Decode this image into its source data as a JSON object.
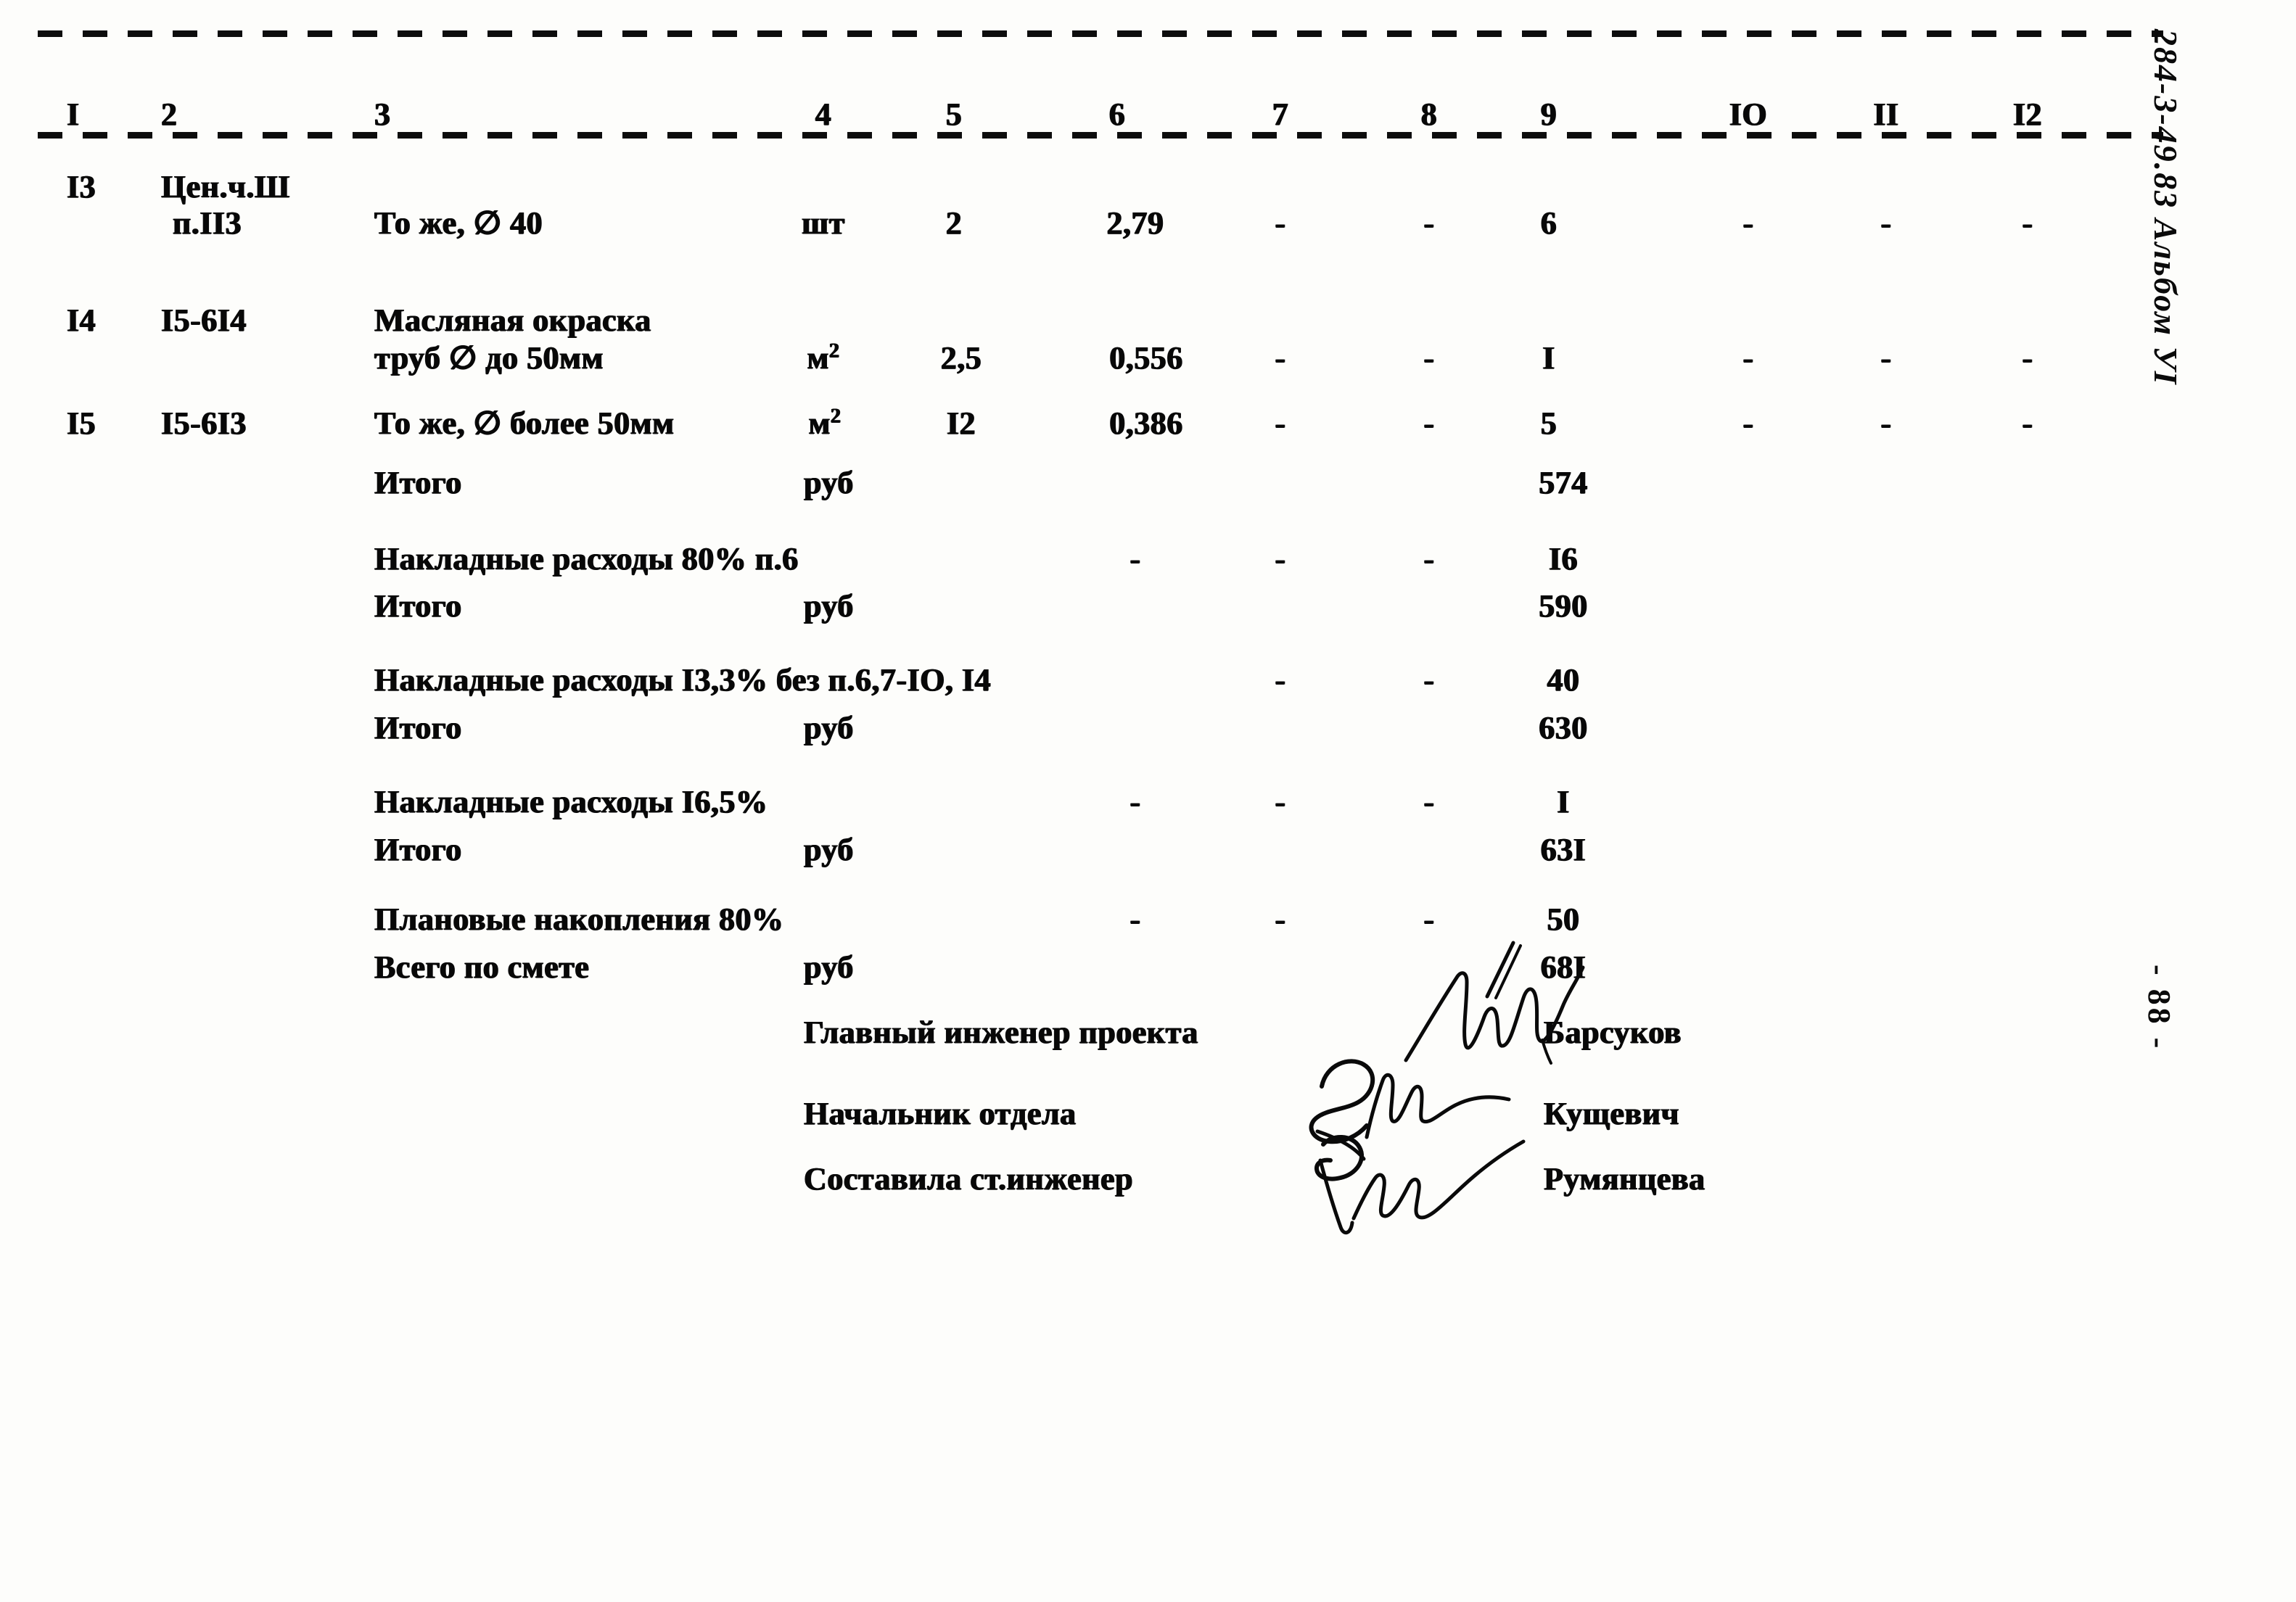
{
  "document": {
    "kind": "construction-cost-estimate-page",
    "margin_code": "284-3-49.83 Альбом УI",
    "page_marker": "- 88 -"
  },
  "table": {
    "column_headers": [
      "I",
      "2",
      "3",
      "4",
      "5",
      "6",
      "7",
      "8",
      "9",
      "IO",
      "II",
      "I2"
    ],
    "dash": "-",
    "rows": [
      {
        "no": "I3",
        "code_line1": "Цен.ч.Ш",
        "code_line2": "п.II3",
        "desc_line1": "",
        "desc_line2": "То же, ∅ 40",
        "unit": "шт",
        "unit_sup": "",
        "c5": "2",
        "c6": "2,79",
        "c7": "-",
        "c8": "-",
        "c9": "6",
        "c10": "-",
        "c11": "-",
        "c12": "-"
      },
      {
        "no": "I4",
        "code_line1": "I5-6I4",
        "code_line2": "",
        "desc_line1": "Масляная окраска",
        "desc_line2": "труб ∅ до 50мм",
        "unit": "м",
        "unit_sup": "2",
        "c5": "2,5",
        "c6": "0,556",
        "c7": "-",
        "c8": "-",
        "c9": "I",
        "c10": "-",
        "c11": "-",
        "c12": "-"
      },
      {
        "no": "I5",
        "code_line1": "I5-6I3",
        "code_line2": "",
        "desc_line1": "",
        "desc_line2": "То же, ∅ более 50мм",
        "unit": "м",
        "unit_sup": "2",
        "c5": "I2",
        "c6": "0,386",
        "c7": "-",
        "c8": "-",
        "c9": "5",
        "c10": "-",
        "c11": "-",
        "c12": "-"
      }
    ],
    "summary_rows": [
      {
        "label": "Итого",
        "unit": "руб",
        "c6": "",
        "c7": "",
        "c8": "",
        "c9": "574"
      },
      {
        "label": "Накладные расходы 80% п.6",
        "unit": "",
        "c6": "-",
        "c7": "-",
        "c8": "-",
        "c9": "I6"
      },
      {
        "label": "Итого",
        "unit": "руб",
        "c6": "",
        "c7": "",
        "c8": "",
        "c9": "590"
      },
      {
        "label": "Накладные расходы I3,3% без п.6,7-IO, I4",
        "unit": "",
        "c6": "",
        "c7": "-",
        "c8": "-",
        "c9": "40"
      },
      {
        "label": "Итого",
        "unit": "руб",
        "c6": "",
        "c7": "",
        "c8": "",
        "c9": "630"
      },
      {
        "label": "Накладные расходы I6,5%",
        "unit": "",
        "c6": "-",
        "c7": "-",
        "c8": "-",
        "c9": "I"
      },
      {
        "label": "Итого",
        "unit": "руб",
        "c6": "",
        "c7": "",
        "c8": "",
        "c9": "63I"
      },
      {
        "label": "Плановые накопления 80%",
        "unit": "",
        "c6": "-",
        "c7": "-",
        "c8": "-",
        "c9": "50"
      },
      {
        "label": "Всего по смете",
        "unit": "руб",
        "c6": "",
        "c7": "",
        "c8": "",
        "c9": "68I"
      }
    ]
  },
  "signatures": [
    {
      "role": "Главный инженер проекта",
      "name": "Барсуков"
    },
    {
      "role": "Начальник отдела",
      "name": "Кущевич"
    },
    {
      "role": "Составила ст.инженер",
      "name": "Румянцева"
    }
  ]
}
